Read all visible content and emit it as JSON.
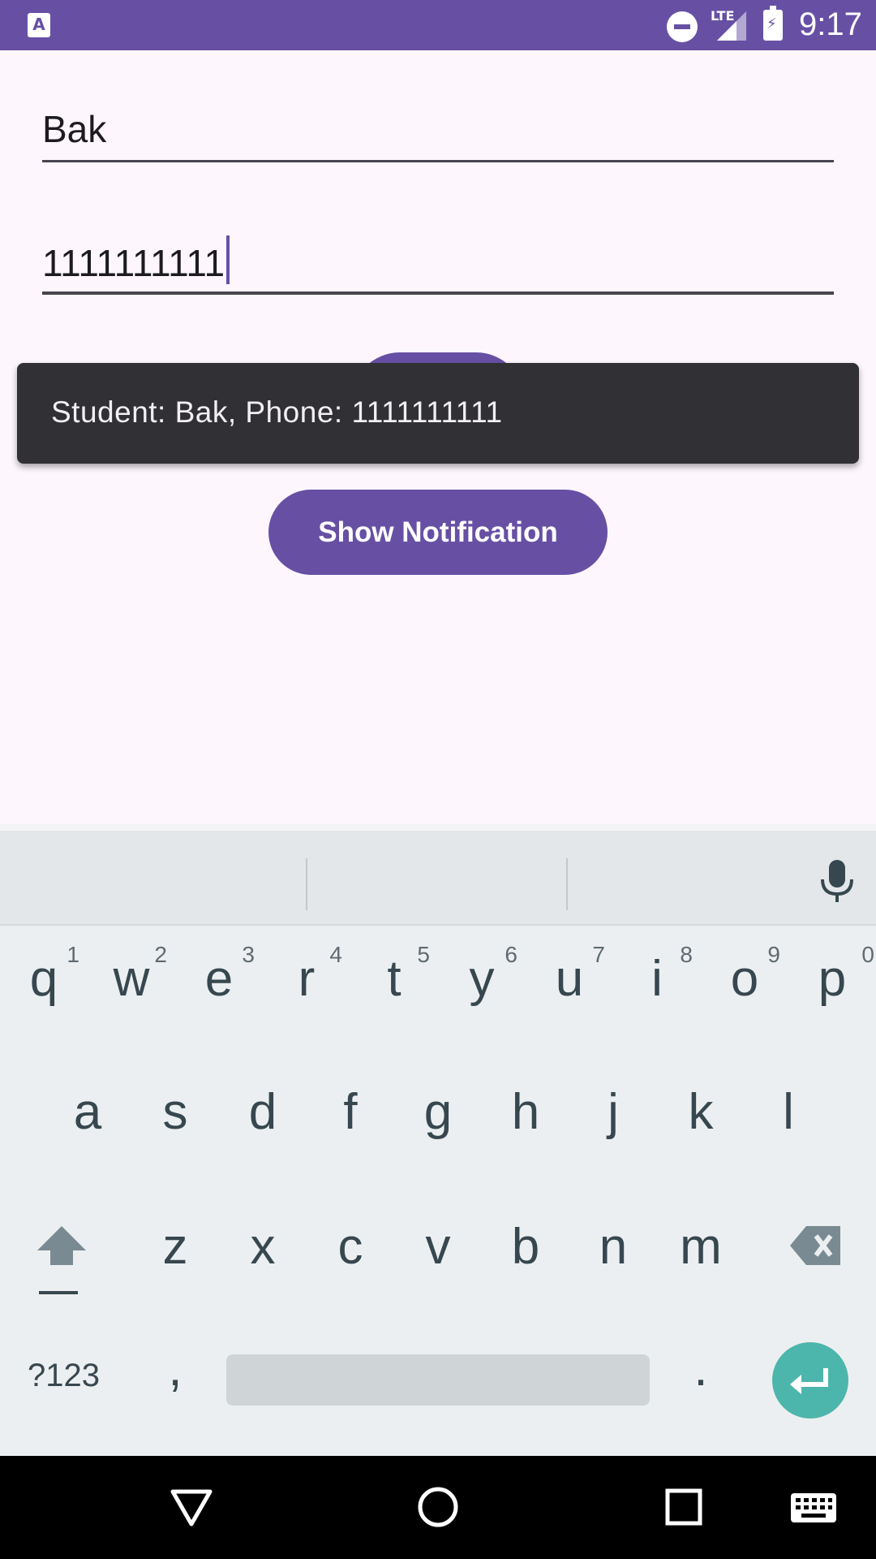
{
  "status_bar": {
    "time": "9:17",
    "network_label": "LTE",
    "app_icon_letter": "A",
    "icons": [
      "app-notification-icon",
      "do-not-disturb-icon",
      "lte-signal-icon",
      "battery-charging-icon"
    ]
  },
  "form": {
    "name_value": "Bak",
    "phone_value": "1111111111"
  },
  "toast": {
    "message": "Student: Bak, Phone: 1111111111"
  },
  "buttons": {
    "show_notification": "Show Notification"
  },
  "keyboard": {
    "row1": [
      {
        "key": "q",
        "hint": "1"
      },
      {
        "key": "w",
        "hint": "2"
      },
      {
        "key": "e",
        "hint": "3"
      },
      {
        "key": "r",
        "hint": "4"
      },
      {
        "key": "t",
        "hint": "5"
      },
      {
        "key": "y",
        "hint": "6"
      },
      {
        "key": "u",
        "hint": "7"
      },
      {
        "key": "i",
        "hint": "8"
      },
      {
        "key": "o",
        "hint": "9"
      },
      {
        "key": "p",
        "hint": "0"
      }
    ],
    "row2": [
      "a",
      "s",
      "d",
      "f",
      "g",
      "h",
      "j",
      "k",
      "l"
    ],
    "row3": [
      "z",
      "x",
      "c",
      "v",
      "b",
      "n",
      "m"
    ],
    "symbols_label": "?123",
    "comma_label": ",",
    "period_label": ".",
    "accent_color": "#4db6ac"
  },
  "colors": {
    "primary": "#6750a4",
    "toast_bg": "#313034",
    "background": "#fdf7fd"
  }
}
